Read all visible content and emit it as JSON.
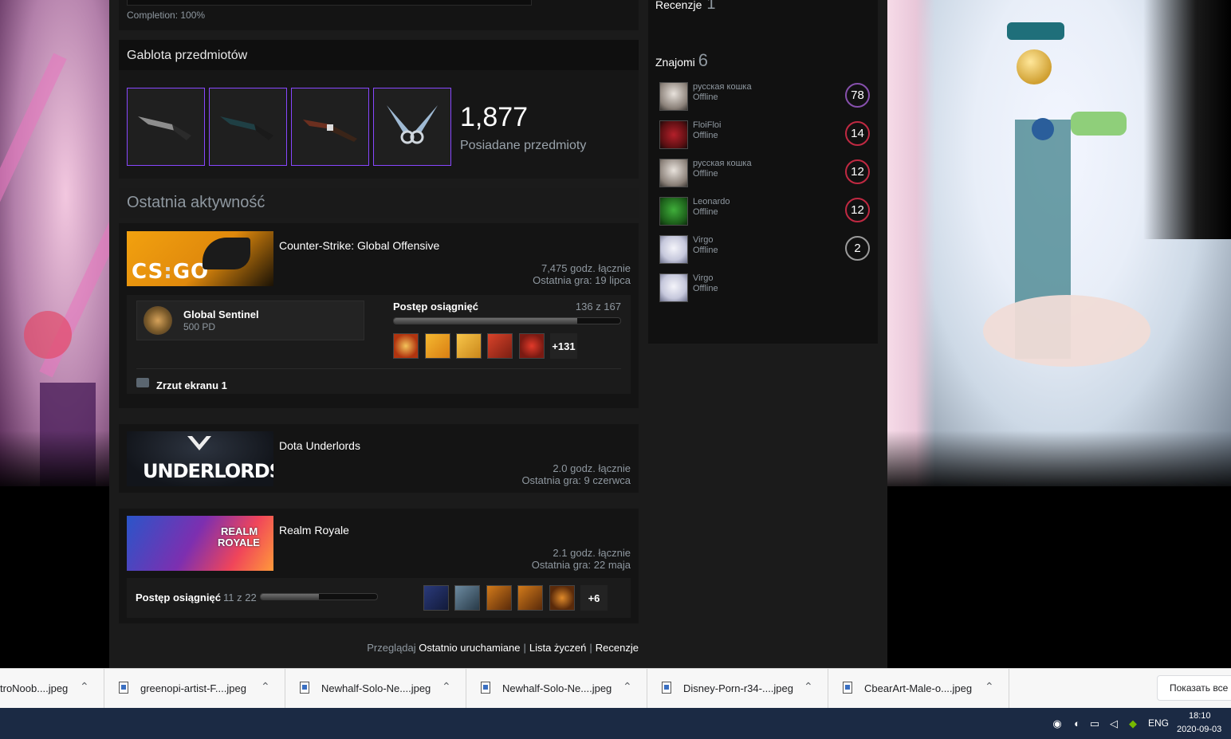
{
  "completion": {
    "text": "Completion: 100%"
  },
  "showcase": {
    "title": "Gablota przedmiotów",
    "count": "1,877",
    "count_label": "Posiadane przedmioty",
    "items": [
      {
        "icon": "knife-huntsman-icon"
      },
      {
        "icon": "knife-huntsman-dark-icon"
      },
      {
        "icon": "knife-flip-icon"
      },
      {
        "icon": "knife-shadow-daggers-icon"
      }
    ]
  },
  "activity": {
    "title": "Ostatnia aktywność",
    "games": [
      {
        "name": "Counter-Strike: Global Offensive",
        "hours": "7,475 godz. łącznie",
        "last_played": "Ostatnia gra: 19 lipca",
        "badge": {
          "name": "Global Sentinel",
          "xp": "500 PD"
        },
        "achievement_label": "Postęp osiągnięć",
        "achievement_count": "136 z 167",
        "achievement_progress": 0.81,
        "achievement_more": "+131",
        "screenshots": "Zrzut ekranu 1"
      },
      {
        "name": "Dota Underlords",
        "hours": "2.0 godz. łącznie",
        "last_played": "Ostatnia gra: 9 czerwca"
      },
      {
        "name": "Realm Royale",
        "hours": "2.1 godz. łącznie",
        "last_played": "Ostatnia gra: 22 maja",
        "achievement_label": "Postęp osiągnięć",
        "achievement_count": "11 z 22",
        "achievement_progress": 0.5,
        "achievement_more": "+6"
      }
    ]
  },
  "footer": {
    "browse": "Przeglądaj",
    "recent": "Ostatnio uruchamiane",
    "wishlist": "Lista życzeń",
    "reviews": "Recenzje",
    "sep": "|"
  },
  "sidebar": {
    "reviews_label": "Recenzje",
    "reviews_count": "1",
    "friends_label": "Znajomi",
    "friends_count": "6",
    "friends": [
      {
        "name": "русская кошка",
        "status": "Offline",
        "level": "78",
        "level_color": "#8650ac"
      },
      {
        "name": "FloiFloi",
        "status": "Offline",
        "level": "14",
        "level_color": "#c02942"
      },
      {
        "name": "русская кошка",
        "status": "Offline",
        "level": "12",
        "level_color": "#c02942"
      },
      {
        "name": "Leonardo",
        "status": "Offline",
        "level": "12",
        "level_color": "#c02942"
      },
      {
        "name": "Virgo",
        "status": "Offline",
        "level": "2",
        "level_color": "#9b9b9b"
      },
      {
        "name": "Virgo",
        "status": "Offline",
        "level": ""
      }
    ]
  },
  "downloads": {
    "items": [
      {
        "name": "troNoob....jpeg"
      },
      {
        "name": "greenopi-artist-F....jpeg"
      },
      {
        "name": "Newhalf-Solo-Ne....jpeg"
      },
      {
        "name": "Newhalf-Solo-Ne....jpeg"
      },
      {
        "name": "Disney-Porn-r34-....jpeg"
      },
      {
        "name": "CbearArt-Male-o....jpeg"
      }
    ],
    "show_all": "Показать все"
  },
  "taskbar": {
    "lang": "ENG",
    "time": "18:10",
    "date": "2020-09-03"
  }
}
